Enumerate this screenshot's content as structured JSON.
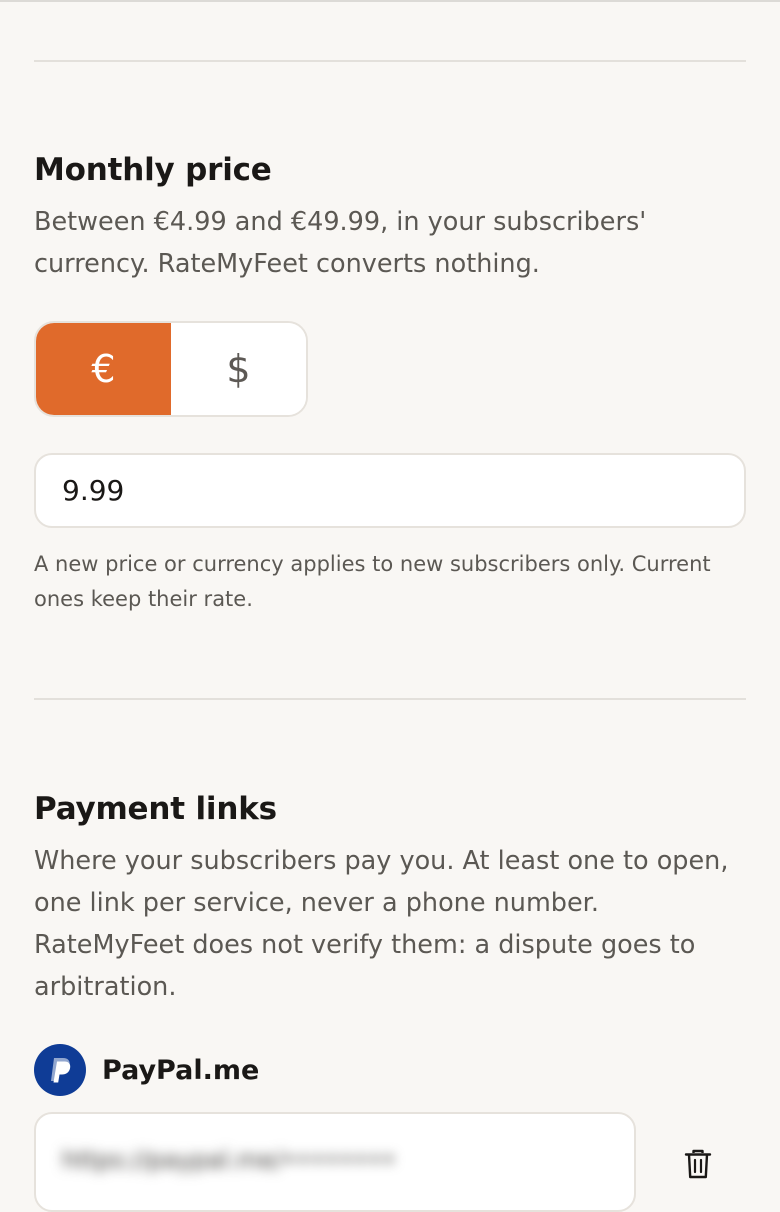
{
  "price_section": {
    "title": "Monthly price",
    "description": "Between €4.99 and €49.99, in your subscribers' currency. RateMyFeet converts nothing.",
    "currencies": [
      {
        "symbol": "€",
        "selected": true
      },
      {
        "symbol": "$",
        "selected": false
      }
    ],
    "price_value": "9.99",
    "help_text": "A new price or currency applies to new subscribers only. Current ones keep their rate."
  },
  "payment_section": {
    "title": "Payment links",
    "description": "Where your subscribers pay you. At least one to open, one link per service, never a phone number. RateMyFeet does not verify them: a dispute goes to arbitration.",
    "services": [
      {
        "name": "PayPal.me",
        "icon": "paypal-icon",
        "link_value": "https://paypal.me/••••••••"
      }
    ]
  },
  "colors": {
    "accent": "#e06a2b",
    "paypal_brand": "#0f3c96",
    "background": "#f9f7f4"
  }
}
